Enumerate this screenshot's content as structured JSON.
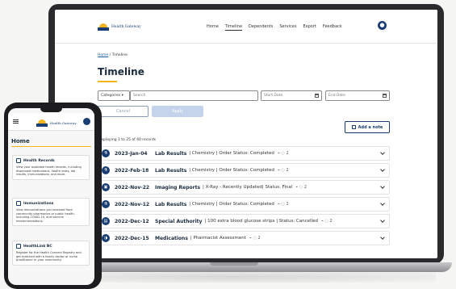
{
  "laptop": {
    "logo_text": "Health Gateway",
    "nav": [
      "Home",
      "Timeline",
      "Dependents",
      "Services",
      "Export",
      "Feedback"
    ],
    "breadcrumb": {
      "home": "Home",
      "separator": " / ",
      "current": "Timeline"
    },
    "page_title": "Timeline",
    "filters": {
      "categories_label": "Categories ▾",
      "search_placeholder": "Search",
      "start_placeholder": "Start Date",
      "end_placeholder": "End Date"
    },
    "buttons": {
      "cancel": "Cancel",
      "apply": "Apply",
      "add_note": "Add a note"
    },
    "records_count": "Displaying 1 to 25 of 40 records",
    "rows": [
      {
        "icon": "flask-icon",
        "glyph": "⚗",
        "date": "2023-Jan-04",
        "type": "Lab Results",
        "desc": "| Chemistry | Order Status: Completed",
        "meta": "⌁  ◌ 2"
      },
      {
        "icon": "flask-icon",
        "glyph": "⚗",
        "date": "2022-Feb-18",
        "type": "Lab Results",
        "desc": "| Chemistry | Order Status: Completed",
        "meta": "⌁  ◌ 2"
      },
      {
        "icon": "image-icon",
        "glyph": "▣",
        "date": "2022-Nov-22",
        "type": "Imaging Reports",
        "desc": "| X-Ray - Recently Updated| Status: Final",
        "meta": "⌁  ◌ 2"
      },
      {
        "icon": "flask-icon",
        "glyph": "⚗",
        "date": "2022-Nov-12",
        "type": "Lab Results",
        "desc": "| Chemistry | Order Status: Completed",
        "meta": "⌁  ◌ 2"
      },
      {
        "icon": "file-icon",
        "glyph": "▤",
        "date": "2022-Dec-12",
        "type": "Special Authority",
        "desc": "| 100 extra blood glucose strips | Status: Cancelled",
        "meta": "⌁  ◌ 2"
      },
      {
        "icon": "pill-icon",
        "glyph": "◑",
        "date": "2022-Dec-15",
        "type": "Medications",
        "desc": "| Pharmacist Assessment",
        "meta": "⌁  ◌ 2"
      }
    ]
  },
  "phone": {
    "logo_text": "Health Gateway",
    "title": "Home",
    "cards": [
      {
        "title": "Health Records",
        "body": "View your available health records, including dispensed medications, health visits, lab results, immunizations, and more."
      },
      {
        "title": "Immunizations",
        "body": "View immunizations you received from community pharmacies or public health, including COVID-19, and vaccine recommendations."
      },
      {
        "title": "HealthLink BC",
        "body": "Register for the Health Connect Registry and get matched with a family doctor or nurse practitioner in your community."
      }
    ]
  },
  "colors": {
    "brand_navy": "#1a3e73",
    "brand_gold": "#f3b51b"
  }
}
